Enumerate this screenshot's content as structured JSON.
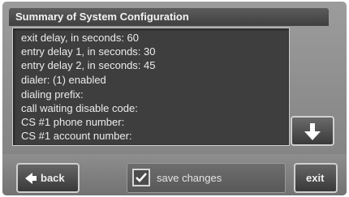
{
  "title": "Summary of System Configuration",
  "config_lines": [
    "exit delay, in seconds:  60",
    "entry delay 1, in seconds:  30",
    "entry delay 2, in seconds:  45",
    "dialer:  (1) enabled",
    "dialing prefix:",
    "call waiting disable code:",
    "CS #1 phone number:",
    "CS #1 account number:"
  ],
  "buttons": {
    "back_label": "back",
    "save_label": "save changes",
    "exit_label": "exit"
  },
  "save_checked": true,
  "icons": {
    "scroll": "arrow-down-icon",
    "back": "arrow-left-icon",
    "check": "checkmark-icon"
  }
}
